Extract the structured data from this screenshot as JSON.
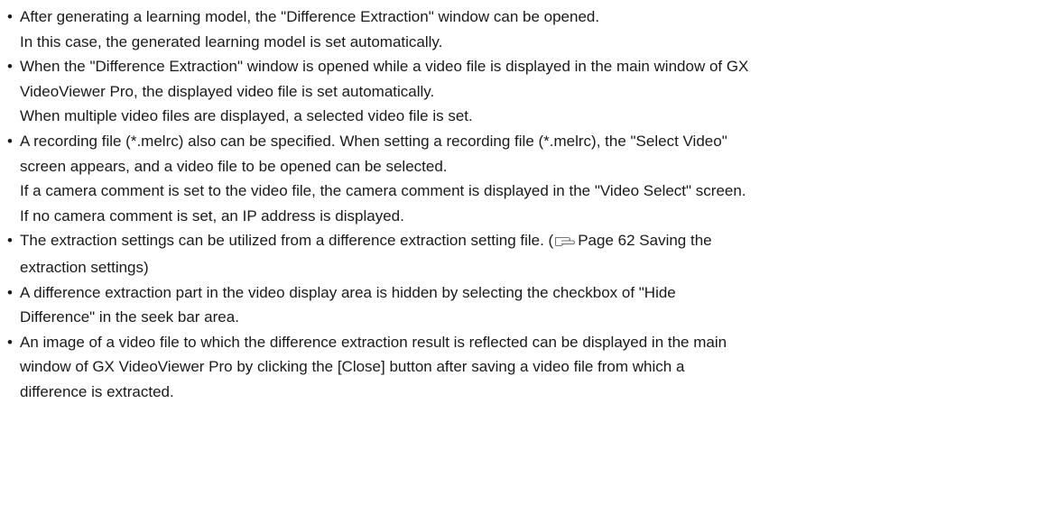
{
  "notes": [
    {
      "lines": [
        "After generating a learning model, the \"Difference Extraction\" window can be opened.",
        "In this case, the generated learning model is set automatically."
      ]
    },
    {
      "lines": [
        "When the \"Difference Extraction\" window is opened while a video file is displayed in the main window of GX",
        "VideoViewer Pro, the displayed video file is set automatically.",
        "When multiple video files are displayed, a selected video file is set."
      ]
    },
    {
      "lines": [
        "A recording file (*.melrc) also can be specified. When setting a recording file (*.melrc), the \"Select Video\"",
        "screen appears, and a video file to be opened can be selected.",
        "If a camera comment is set to the video file, the camera comment is displayed in the \"Video Select\" screen.",
        "If no camera comment is set, an IP address is displayed."
      ]
    },
    {
      "line1_before": "The extraction settings can be utilized from a difference extraction setting file. (",
      "ref_icon": "pointing-hand-reference-icon",
      "line1_after": "Page 62 Saving the",
      "line2": "extraction settings)"
    },
    {
      "lines": [
        "A difference extraction part in the video display area is hidden by selecting the checkbox of \"Hide",
        "Difference\" in the seek bar area."
      ]
    },
    {
      "lines": [
        "An image of a video file to which the difference extraction result is reflected can be displayed in the main",
        "window of GX VideoViewer Pro by clicking the [Close] button after saving a video file from which a",
        "difference is extracted."
      ]
    }
  ],
  "bullet_char": "•"
}
